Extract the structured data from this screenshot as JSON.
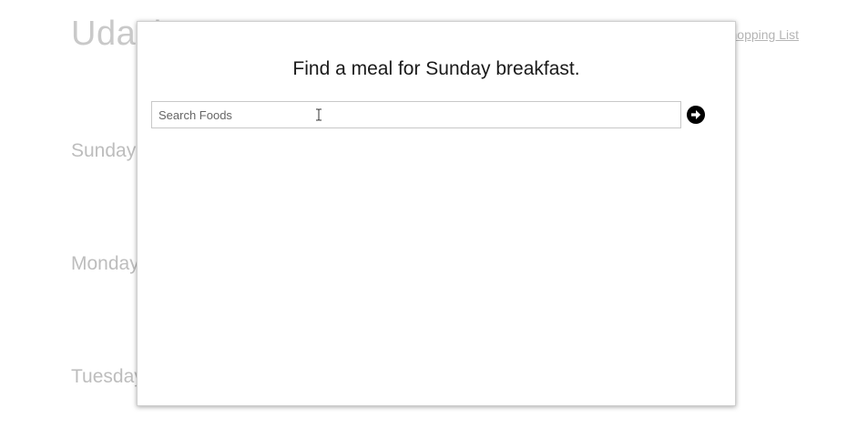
{
  "background": {
    "title": "Udacity",
    "shopping_link": "Shopping List",
    "days": [
      "Sunday",
      "Monday",
      "Tuesday"
    ]
  },
  "modal": {
    "heading": "Find a meal for Sunday breakfast.",
    "search": {
      "placeholder": "Search Foods",
      "value": ""
    },
    "go_icon": "arrow-circle-right-icon"
  },
  "colors": {
    "background_text": "#c9c9c9",
    "heading_text": "#1a1a1a",
    "icon": "#000000"
  }
}
